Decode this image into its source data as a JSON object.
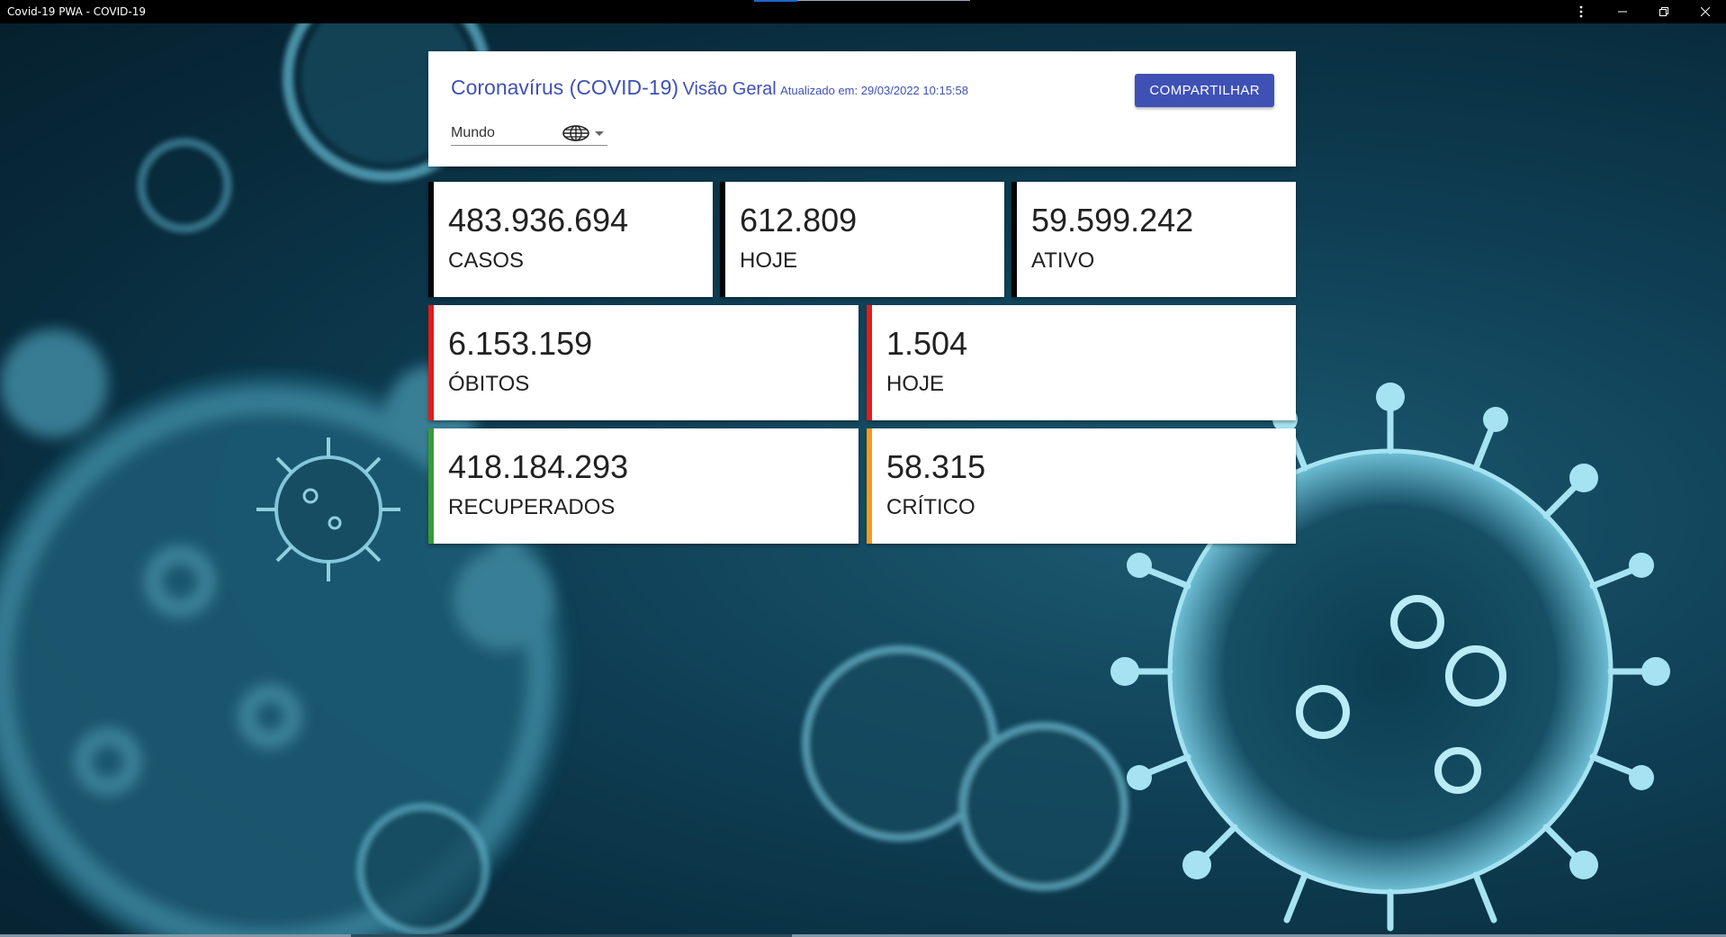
{
  "window": {
    "title": "Covid-19 PWA - COVID-19",
    "menu_icon": "more-vert-icon",
    "minimize_icon": "minimize-icon",
    "restore_icon": "restore-icon",
    "close_icon": "close-icon"
  },
  "header": {
    "title_main": "Coronavírus (COVID-19)",
    "title_sub": "Visão Geral",
    "updated_label": "Atualizado em: 29/03/2022 10:15:58",
    "share_button": "COMPARTILHAR",
    "region": {
      "selected": "Mundo",
      "icon": "globe-icon"
    }
  },
  "stats": {
    "cases": {
      "value": "483.936.694",
      "label": "CASOS"
    },
    "cases_today": {
      "value": "612.809",
      "label": "HOJE"
    },
    "active": {
      "value": "59.599.242",
      "label": "ATIVO"
    },
    "deaths": {
      "value": "6.153.159",
      "label": "ÓBITOS"
    },
    "deaths_today": {
      "value": "1.504",
      "label": "HOJE"
    },
    "recovered": {
      "value": "418.184.293",
      "label": "RECUPERADOS"
    },
    "critical": {
      "value": "58.315",
      "label": "CRÍTICO"
    }
  },
  "colors": {
    "brand": "#3f51b5",
    "cases_accent": "#050505",
    "deaths_accent": "#e31b1b",
    "recovered_accent": "#3a9a36",
    "critical_accent": "#f39a1f"
  }
}
